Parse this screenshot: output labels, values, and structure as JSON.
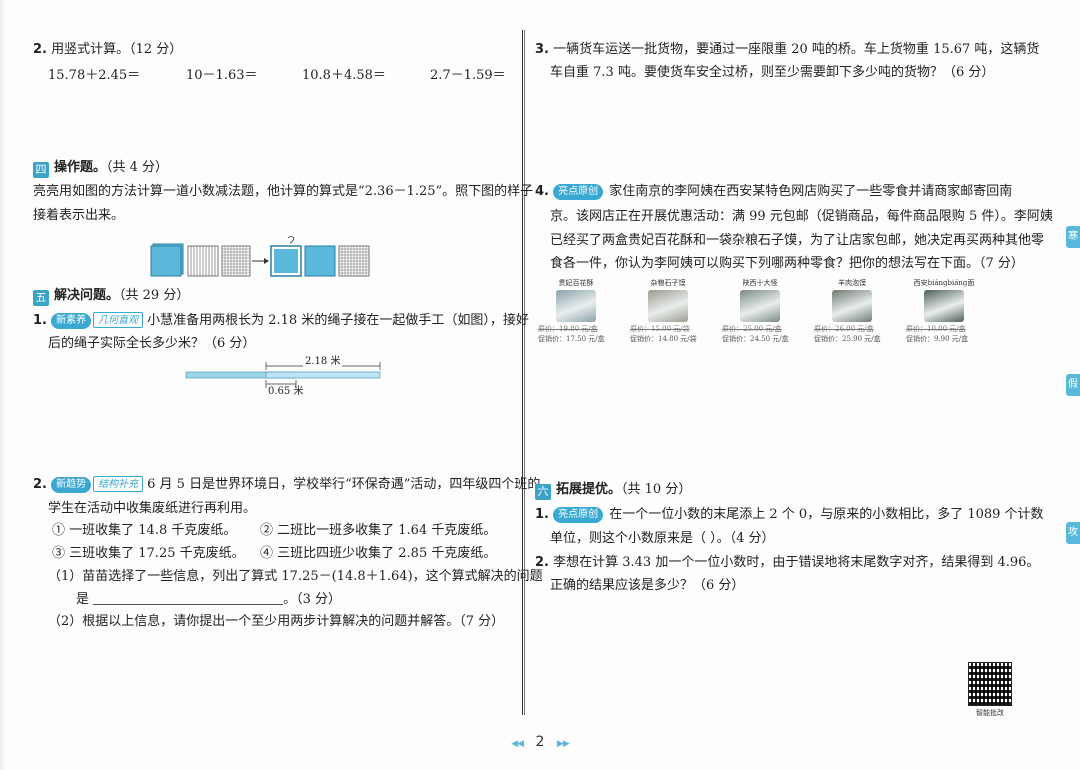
{
  "left": {
    "q2": {
      "num": "2.",
      "title": "用竖式计算。（12 分）",
      "exprs": [
        "15.78＋2.45＝",
        "10－1.63＝",
        "10.8＋4.58＝",
        "2.7－1.59＝"
      ]
    },
    "sec4": {
      "badge": "四",
      "title": "操作题。",
      "score": "（共 4 分）",
      "text1": "亮亮用如图的方法计算一道小数减法题，他计算的算式是“2.36－1.25”。照下图的样子",
      "text2": "接着表示出来。"
    },
    "sec5": {
      "badge": "五",
      "title": "解决问题。",
      "score": "（共 29 分）",
      "q1": {
        "num": "1.",
        "tag": "新素养",
        "tag2": "几何直观",
        "text1": "小慧准备用两根长为 2.18 米的绳子接在一起做手工（如图），接好",
        "text2": "后的绳子实际全长多少米？（6 分）",
        "label_top": "2.18 米",
        "label_bottom": "0.65 米"
      },
      "q2": {
        "num": "2.",
        "tag": "新趋势",
        "tag2": "结构补充",
        "text1": "6 月 5 日是世界环境日，学校举行“环保奇遇”活动，四年级四个班的",
        "text2": "学生在活动中收集废纸进行再利用。",
        "info1": "① 一班收集了 14.8 千克废纸。",
        "info2": "② 二班比一班多收集了 1.64 千克废纸。",
        "info3": "③ 三班收集了 17.25 千克废纸。",
        "info4": "④ 三班比四班少收集了 2.85 千克废纸。",
        "sub1a": "（1）苗苗选择了一些信息，列出了算式 17.25－(14.8＋1.64)，这个算式解决的问题",
        "sub1b_pre": "是",
        "sub1b_post": "。（3 分）",
        "sub2": "（2）根据以上信息，请你提出一个至少用两步计算解决的问题并解答。（7 分）"
      }
    }
  },
  "right": {
    "q3": {
      "num": "3.",
      "text1": "一辆货车运送一批货物，要通过一座限重 20 吨的桥。车上货物重 15.67 吨，这辆货",
      "text2": "车自重 7.3 吨。要使货车安全过桥，则至少需要卸下多少吨的货物？（6 分）"
    },
    "q4": {
      "num": "4.",
      "tag": "亮点原创",
      "text1": "家住南京的李阿姨在西安某特色网店购买了一些零食并请商家邮寄回南",
      "text2": "京。该网店正在开展优惠活动：满 99 元包邮（促销商品，每件商品限购 5 件）。李阿姨",
      "text3": "已经买了两盒贵妃百花酥和一袋杂粮石子馍，为了让店家包邮，她决定再买两种其他零",
      "text4": "食各一件，你认为李阿姨可以购买下列哪两种零食？把你的想法写在下面。（7 分）",
      "products": [
        {
          "name": "贵妃百花酥",
          "orig": "原价：19.80 元/盒",
          "promo": "促销价：17.50 元/盒",
          "color": "#8aa3ad"
        },
        {
          "name": "杂粮石子馍",
          "orig": "原价：15.00 元/袋",
          "promo": "促销价：14.80 元/袋",
          "color": "#9a9a8e"
        },
        {
          "name": "陕西十大怪",
          "orig": "原价：25.00 元/盒",
          "promo": "促销价：24.50 元/盒",
          "color": "#7c8a84"
        },
        {
          "name": "羊肉泡馍",
          "orig": "原价：26.00 元/盒",
          "promo": "促销价：25.90 元/盒",
          "color": "#6f7a72"
        },
        {
          "name": "西安biángbiáng面",
          "orig": "原价：10.00 元/盒",
          "promo": "促销价：9.90 元/盒",
          "color": "#4f5f5a"
        }
      ]
    },
    "sec6": {
      "badge": "六",
      "title": "拓展提优。",
      "score": "（共 10 分）",
      "q1": {
        "num": "1.",
        "tag": "亮点原创",
        "text1": "在一个一位小数的末尾添上 2 个 0，与原来的小数相比，多了 1089 个计数",
        "text2": "单位，则这个小数原来是（    ）。（4 分）"
      },
      "q2": {
        "num": "2.",
        "text1": "李想在计算 3.43 加一个一位小数时，由于错误地将末尾数字对齐，结果得到 4.96。",
        "text2": "正确的结果应该是多少？（6 分）"
      }
    },
    "qr_label": "智能批改"
  },
  "side_tabs": [
    "寒",
    "假",
    "攻"
  ],
  "footer": {
    "page": "2",
    "prev": "◀◀",
    "next": "▶▶"
  },
  "colors": {
    "accent": "#39a9d4",
    "grid_fill": "#5ab8db"
  }
}
